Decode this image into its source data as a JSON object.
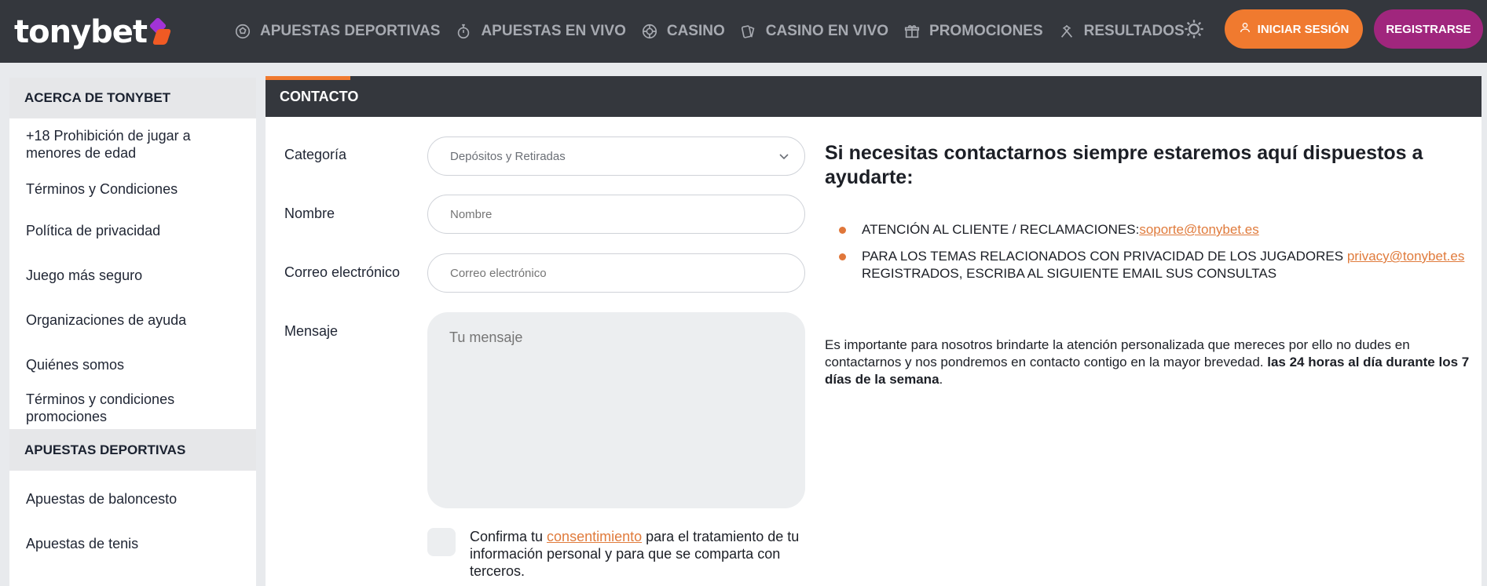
{
  "header": {
    "logo_text": "tonybet",
    "nav": [
      {
        "label": "APUESTAS DEPORTIVAS",
        "icon": "soccer-ball-icon"
      },
      {
        "label": "APUESTAS EN VIVO",
        "icon": "stopwatch-icon"
      },
      {
        "label": "CASINO",
        "icon": "roulette-icon"
      },
      {
        "label": "CASINO EN VIVO",
        "icon": "cards-icon"
      },
      {
        "label": "PROMOCIONES",
        "icon": "gift-icon"
      },
      {
        "label": "RESULTADOS",
        "icon": "hammers-icon"
      }
    ],
    "theme_icon": "sun-icon",
    "login_label": "INICIAR SESIÓN",
    "login_icon": "user-icon",
    "register_label": "REGISTRARSE",
    "colors": {
      "bar": "#34373d",
      "login": "#f07a2f",
      "register": "#a0267d"
    }
  },
  "sidebar": {
    "section_about": "ACERCA DE TONYBET",
    "items_about": [
      "+18 Prohibición de jugar a menores de edad",
      "Términos y Condiciones",
      "Política de privacidad",
      "Juego más seguro",
      "Organizaciones de ayuda",
      "Quiénes somos",
      "Términos y condiciones promociones"
    ],
    "section_sports": "APUESTAS DEPORTIVAS",
    "items_sports": [
      "Apuestas de baloncesto",
      "Apuestas de tenis"
    ]
  },
  "contact": {
    "title": "CONTACTO",
    "category_label": "Categoría",
    "category_value": "Depósitos y Retiradas",
    "name_label": "Nombre",
    "name_placeholder": "Nombre",
    "email_label": "Correo electrónico",
    "email_placeholder": "Correo electrónico",
    "message_label": "Mensaje",
    "message_placeholder": "Tu mensaje",
    "consent_prefix": "Confirma tu ",
    "consent_link": "consentimiento",
    "consent_suffix": " para el tratamiento de tu información personal y para que se comparta con terceros."
  },
  "info": {
    "heading": "Si necesitas contactarnos siempre estaremos aquí dispuestos a ayudarte:",
    "bullet1_text": "ATENCIÓN AL CLIENTE / RECLAMACIONES:",
    "bullet1_email": "soporte@tonybet.es",
    "bullet2_text": "PARA LOS TEMAS RELACIONADOS CON PRIVACIDAD DE LOS JUGADORES ",
    "bullet2_email": "privacy@tonybet.es",
    "bullet2_suffix": " REGISTRADOS, ESCRIBA AL SIGUIENTE EMAIL SUS CONSULTAS",
    "paragraph": "Es importante para nosotros brindarte la atención personalizada que mereces por ello no dudes en contactarnos y nos pondremos en contacto contigo en la mayor brevedad. ",
    "paragraph_bold": "las 24 horas al día durante los 7 días de la semana",
    "paragraph_end": "."
  }
}
